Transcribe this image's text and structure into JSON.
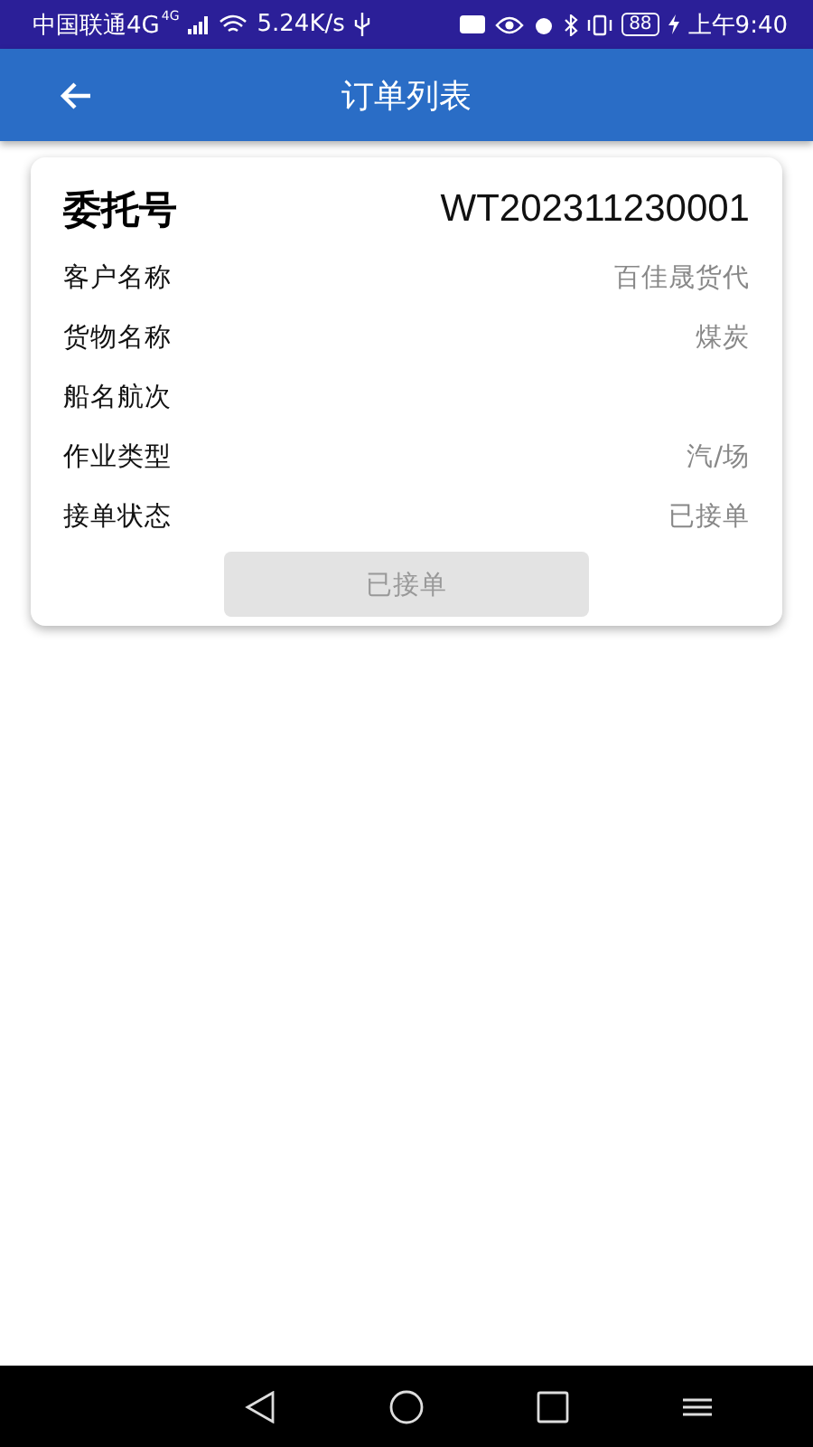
{
  "status_bar": {
    "carrier": "中国联通4G",
    "network_type": "4G",
    "speed": "5.24K/s",
    "battery": "88",
    "time": "上午9:40"
  },
  "app_bar": {
    "title": "订单列表"
  },
  "order": {
    "number_label": "委托号",
    "number": "WT202311230001",
    "fields": [
      {
        "label": "客户名称",
        "value": "百佳晟货代"
      },
      {
        "label": "货物名称",
        "value": "煤炭"
      },
      {
        "label": "船名航次"
      },
      {
        "label": "作业类型",
        "value": "汽/场"
      },
      {
        "label": "接单状态",
        "value": "已接单"
      }
    ],
    "button": {
      "label": "已接单",
      "disabled": true
    }
  }
}
